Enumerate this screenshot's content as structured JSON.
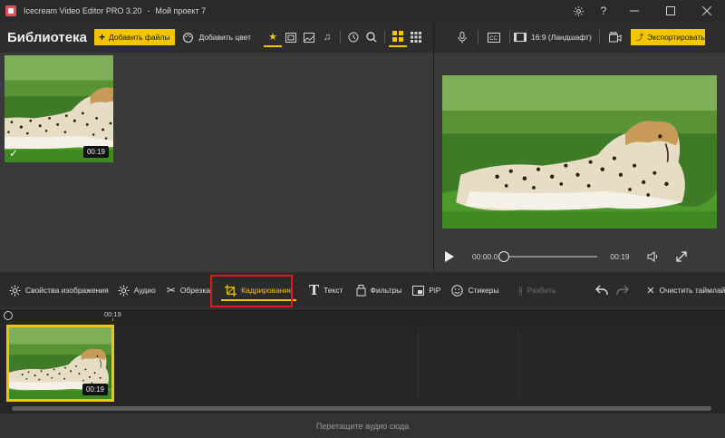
{
  "titlebar": {
    "app_name": "Icecream Video Editor PRO 3.20",
    "separator": "-",
    "project_name": "Мой проект 7"
  },
  "library": {
    "title": "Библиотека",
    "add_files_label": "Добавить файлы",
    "add_color_label": "Добавить цвет",
    "items": [
      {
        "duration": "00:19",
        "selected": true
      }
    ]
  },
  "preview_toolbar": {
    "aspect_label": "16:9 (Ландшафт)",
    "export_label": "Экспортировать видео"
  },
  "player": {
    "current_time": "00:00.0",
    "total_time": "00:19",
    "progress": 0
  },
  "edit_tools": {
    "image_props": "Свойства изображения",
    "audio": "Аудио",
    "trim": "Обрезка",
    "crop": "Кадрирование",
    "text": "Текст",
    "filters": "Фильтры",
    "pip": "PiP",
    "stickers": "Стикеры",
    "split": "Разбить",
    "clear_timeline": "Очистить таймлайн"
  },
  "timeline": {
    "ruler_label": "00:19",
    "clip_duration": "00:19",
    "audio_drop_hint": "Перетащите аудио сюда"
  },
  "colors": {
    "accent": "#f2c500",
    "highlight_box": "#e01b1b"
  }
}
